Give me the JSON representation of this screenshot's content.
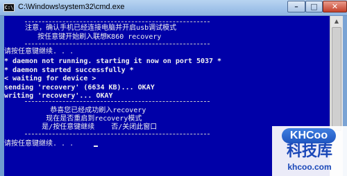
{
  "window": {
    "title": "C:\\Windows\\system32\\cmd.exe",
    "app_icon": "cmd-icon",
    "icon_text": "C:\\",
    "controls": {
      "minimize": "–",
      "maximize": "□",
      "close": "✕"
    }
  },
  "console": {
    "lines": [
      "     注意，确认手机已经连接电脑并开启usb调试模式",
      "        按任意键开始刷入联想K860 recovery",
      "请按任意键继续. . .",
      "* daemon not running. starting it now on port 5037 *",
      "* daemon started successfully *",
      "< waiting for device >",
      "sending 'recovery' (6634 KB)... OKAY",
      "writing 'recovery'... OKAY",
      "           恭喜您已经成功刷入recovery",
      "          现在是否重启到recovery模式",
      "         是/按任意键继续    否/关闭此窗口",
      "请按任意键继续. . ."
    ]
  },
  "watermark": {
    "logo_text": "KHCoo",
    "name": "科技库",
    "domain": "khcoo.com"
  },
  "colors": {
    "console_bg": "#0000a8",
    "console_text": "#f0f0f0",
    "watermark_blue": "#1a47b8"
  }
}
